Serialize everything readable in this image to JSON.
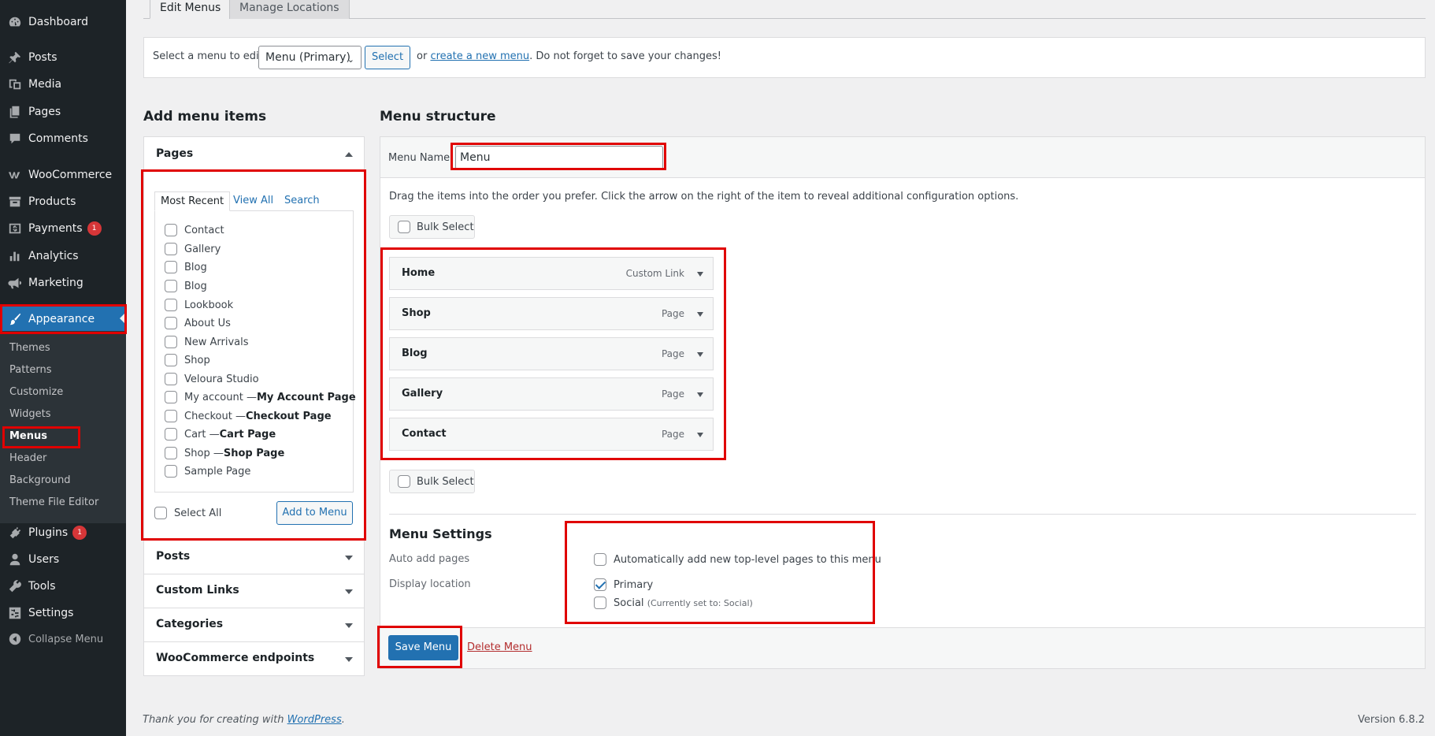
{
  "sidebar": {
    "items": [
      {
        "label": "Dashboard",
        "icon": "dashboard-icon"
      },
      {
        "label": "Posts",
        "icon": "pin-icon"
      },
      {
        "label": "Media",
        "icon": "media-icon"
      },
      {
        "label": "Pages",
        "icon": "pages-icon"
      },
      {
        "label": "Comments",
        "icon": "comment-icon"
      },
      {
        "label": "WooCommerce",
        "icon": "woocommerce-icon"
      },
      {
        "label": "Products",
        "icon": "archive-icon"
      },
      {
        "label": "Payments",
        "icon": "payments-icon",
        "badge": "1"
      },
      {
        "label": "Analytics",
        "icon": "bar-chart-icon"
      },
      {
        "label": "Marketing",
        "icon": "megaphone-icon"
      },
      {
        "label": "Appearance",
        "icon": "paintbrush-icon"
      },
      {
        "label": "Plugins",
        "icon": "plug-icon",
        "badge": "1"
      },
      {
        "label": "Users",
        "icon": "user-icon"
      },
      {
        "label": "Tools",
        "icon": "wrench-icon"
      },
      {
        "label": "Settings",
        "icon": "settings-icon"
      }
    ],
    "submenu": [
      "Themes",
      "Patterns",
      "Customize",
      "Widgets",
      "Menus",
      "Header",
      "Background",
      "Theme File Editor"
    ],
    "collapse_label": "Collapse Menu"
  },
  "tabs": {
    "edit": "Edit Menus",
    "manage": "Manage Locations"
  },
  "select_bar": {
    "label": "Select a menu to edit:",
    "selected": "Menu (Primary)",
    "select_button": "Select",
    "or": "or",
    "create_link": "create a new menu",
    "suffix": ". Do not forget to save your changes!"
  },
  "add_items": {
    "heading": "Add menu items",
    "pages": {
      "title": "Pages",
      "tabs": [
        "Most Recent",
        "View All",
        "Search"
      ],
      "items": [
        {
          "text": "Contact",
          "suffix": ""
        },
        {
          "text": "Gallery",
          "suffix": ""
        },
        {
          "text": "Blog",
          "suffix": ""
        },
        {
          "text": "Blog",
          "suffix": ""
        },
        {
          "text": "Lookbook",
          "suffix": ""
        },
        {
          "text": "About Us",
          "suffix": ""
        },
        {
          "text": "New Arrivals",
          "suffix": ""
        },
        {
          "text": "Shop",
          "suffix": ""
        },
        {
          "text": "Veloura Studio",
          "suffix": ""
        },
        {
          "text": "My account — ",
          "suffix": "My Account Page"
        },
        {
          "text": "Checkout — ",
          "suffix": "Checkout Page"
        },
        {
          "text": "Cart — ",
          "suffix": "Cart Page"
        },
        {
          "text": "Shop — ",
          "suffix": "Shop Page"
        },
        {
          "text": "Sample Page",
          "suffix": ""
        }
      ],
      "select_all": "Select All",
      "add_button": "Add to Menu"
    },
    "other_sections": [
      "Posts",
      "Custom Links",
      "Categories",
      "WooCommerce endpoints"
    ]
  },
  "structure": {
    "heading": "Menu structure",
    "name_label": "Menu Name",
    "name_value": "Menu",
    "instructions": "Drag the items into the order you prefer. Click the arrow on the right of the item to reveal additional configuration options.",
    "bulk_select": "Bulk Select",
    "items": [
      {
        "title": "Home",
        "type": "Custom Link"
      },
      {
        "title": "Shop",
        "type": "Page"
      },
      {
        "title": "Blog",
        "type": "Page"
      },
      {
        "title": "Gallery",
        "type": "Page"
      },
      {
        "title": "Contact",
        "type": "Page"
      }
    ]
  },
  "settings": {
    "heading": "Menu Settings",
    "auto_add_label": "Auto add pages",
    "auto_add_option": "Automatically add new top-level pages to this menu",
    "auto_add_checked": false,
    "display_label": "Display location",
    "locations": [
      {
        "name": "Primary",
        "note": "",
        "checked": true
      },
      {
        "name": "Social",
        "note": "(Currently set to: Social)",
        "checked": false
      }
    ]
  },
  "actions": {
    "save": "Save Menu",
    "delete": "Delete Menu"
  },
  "footer": {
    "prefix": "Thank you for creating with ",
    "link": "WordPress",
    "suffix": ".",
    "version": "Version 6.8.2"
  },
  "colors": {
    "sidebar": "#1d2327",
    "accent": "#2271b1",
    "highlight": "#e00000",
    "badge": "#d63638"
  }
}
